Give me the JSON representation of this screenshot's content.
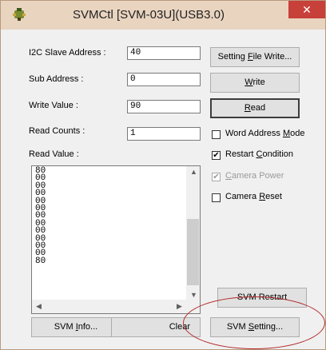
{
  "window": {
    "title": "SVMCtl [SVM-03U](USB3.0)",
    "close_glyph": "✕"
  },
  "form": {
    "i2c_label": "I2C Slave Address :",
    "i2c_value": "40",
    "sub_label": "Sub Address :",
    "sub_value": "0",
    "write_label": "Write Value :",
    "write_value": "90",
    "counts_label": "Read Counts :",
    "counts_value": "1",
    "readvalue_label": "Read Value :"
  },
  "read_values": [
    "80",
    "00",
    "00",
    "00",
    "00",
    "00",
    "00",
    "00",
    "00",
    "00",
    "00",
    "00",
    "80"
  ],
  "buttons": {
    "setting_file_write": {
      "pre": "Setting ",
      "u": "F",
      "post": "ile Write..."
    },
    "write": {
      "pre": "",
      "u": "W",
      "post": "rite"
    },
    "read": {
      "pre": "",
      "u": "R",
      "post": "ead"
    },
    "svm_restart": {
      "pre": "SVM Restart",
      "u": "",
      "post": ""
    },
    "svm_info": {
      "pre": "SVM ",
      "u": "I",
      "post": "nfo..."
    },
    "clear": {
      "pre": "Clear",
      "u": "",
      "post": ""
    },
    "svm_setting": {
      "pre": "SVM ",
      "u": "S",
      "post": "etting..."
    }
  },
  "checkboxes": {
    "word_address_mode": {
      "pre": "Word Address ",
      "u": "M",
      "post": "ode",
      "checked": false,
      "enabled": true
    },
    "restart_condition": {
      "pre": "Restart ",
      "u": "C",
      "post": "ondition",
      "checked": true,
      "enabled": true
    },
    "camera_power": {
      "pre": "",
      "u": "C",
      "post": "amera Power",
      "checked": true,
      "enabled": false
    },
    "camera_reset": {
      "pre": "Camera ",
      "u": "R",
      "post": "eset",
      "checked": false,
      "enabled": true
    }
  },
  "glyphs": {
    "check": "✔",
    "up": "▲",
    "down": "▼",
    "left": "◀",
    "right": "▶"
  },
  "colors": {
    "titlebar": "#e9d4c0",
    "close": "#c7403a",
    "highlight": "#b22a2a"
  }
}
